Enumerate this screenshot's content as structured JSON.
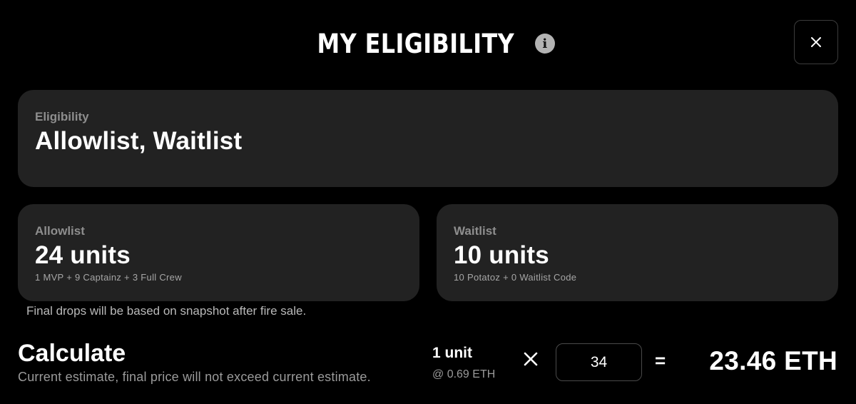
{
  "modal": {
    "title": "MY ELIGIBILITY",
    "info_icon": "info-icon",
    "close_icon": "close-icon"
  },
  "eligibility": {
    "label": "Eligibility",
    "value": "Allowlist, Waitlist"
  },
  "allowlist": {
    "label": "Allowlist",
    "units": "24 units",
    "breakdown": "1 MVP + 9 Captainz + 3 Full Crew"
  },
  "waitlist": {
    "label": "Waitlist",
    "units": "10 units",
    "breakdown": "10 Potatoz + 0 Waitlist Code"
  },
  "note": "Final drops will be based on snapshot after fire sale.",
  "calculate": {
    "title": "Calculate",
    "subtitle": "Current estimate, final price will not exceed current estimate.",
    "unit_label": "1 unit",
    "unit_price": "@ 0.69 ETH",
    "multiply_icon": "multiply-icon",
    "quantity": "34",
    "equals": "=",
    "total": "23.46 ETH"
  },
  "colors": {
    "background": "#000000",
    "card": "#222222",
    "muted_text": "#8e8e8e",
    "text": "#ffffff"
  }
}
